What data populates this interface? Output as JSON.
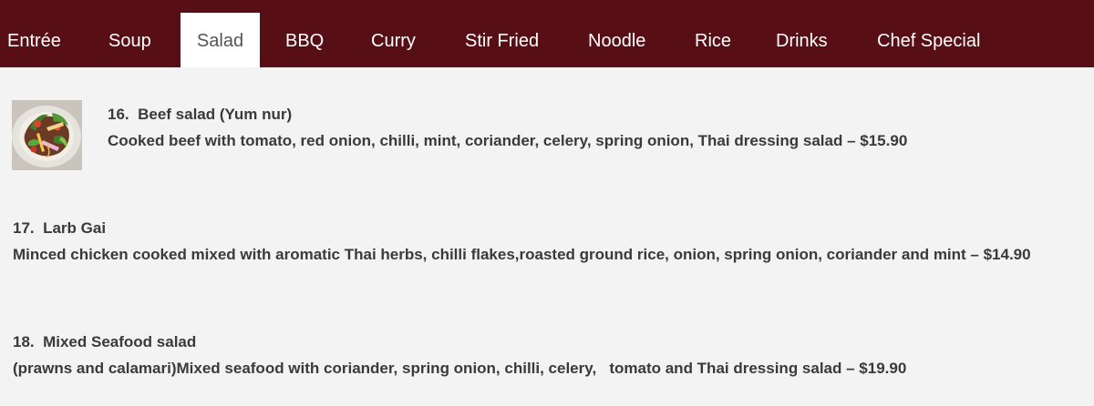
{
  "tabs": [
    {
      "label": "Entrée"
    },
    {
      "label": "Soup"
    },
    {
      "label": "Salad"
    },
    {
      "label": "BBQ"
    },
    {
      "label": "Curry"
    },
    {
      "label": "Stir Fried"
    },
    {
      "label": "Noodle"
    },
    {
      "label": "Rice"
    },
    {
      "label": "Drinks"
    },
    {
      "label": "Chef Special"
    }
  ],
  "active_tab": "Salad",
  "items": [
    {
      "number": "16.",
      "name": "Beef salad (Yum nur)",
      "description": "Cooked beef with tomato, red onion, chilli, mint, coriander, celery, spring onion, Thai dressing salad – $15.90"
    },
    {
      "number": "17.",
      "name": "Larb Gai",
      "description": "Minced chicken cooked mixed with aromatic Thai herbs, chilli flakes,roasted ground rice, onion, spring onion, coriander and mint – $14.90"
    },
    {
      "number": "18.",
      "name": "Mixed Seafood salad",
      "description": "(prawns and calamari)Mixed seafood with coriander, spring onion, chilli, celery,   tomato and Thai dressing salad – $19.90"
    }
  ],
  "colors": {
    "tabbar_bg": "#570e15",
    "page_bg": "#f3f3f3",
    "text": "#3a3a3a"
  }
}
